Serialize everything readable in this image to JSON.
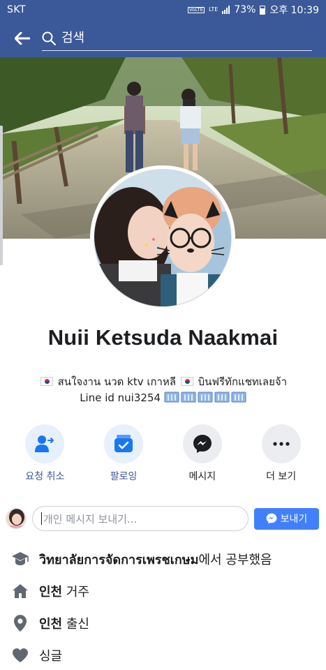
{
  "status_bar": {
    "carrier": "SKT",
    "volte": "VoLTE",
    "lte": "LTE",
    "battery": "73%",
    "time": "오후 10:39"
  },
  "search": {
    "placeholder": "검색"
  },
  "profile": {
    "name": "Nuii Ketsuda Naakmai",
    "bio_line1": "สนใจงาน นวด ktv เกาหลี",
    "bio_line1_b": "บินฟรีทักแชทเลยจ้า",
    "bio_line2": "Line id nui3254"
  },
  "actions": [
    {
      "label": "요청 취소",
      "icon": "cancel-request-icon"
    },
    {
      "label": "팔로잉",
      "icon": "following-icon"
    },
    {
      "label": "메시지",
      "icon": "messenger-icon"
    },
    {
      "label": "더 보기",
      "icon": "more-icon"
    }
  ],
  "composer": {
    "placeholder": "개인 메시지 보내기...",
    "send_label": "보내기"
  },
  "info": {
    "education_bold": "วิทยาลัยการจัดการเพรชเกษม",
    "education_suffix": "에서 공부했음",
    "lives_bold": "인천",
    "lives_suffix": " 거주",
    "from_bold": "인천",
    "from_suffix": " 출신",
    "relationship": "싱글"
  },
  "colors": {
    "header_blue": "#3b5998",
    "link_blue": "#385898",
    "send_blue": "#4080ff",
    "action_bg_blue": "#e7f0fd",
    "action_bg_gray": "#ebedf0",
    "icon_gray": "#606770"
  }
}
